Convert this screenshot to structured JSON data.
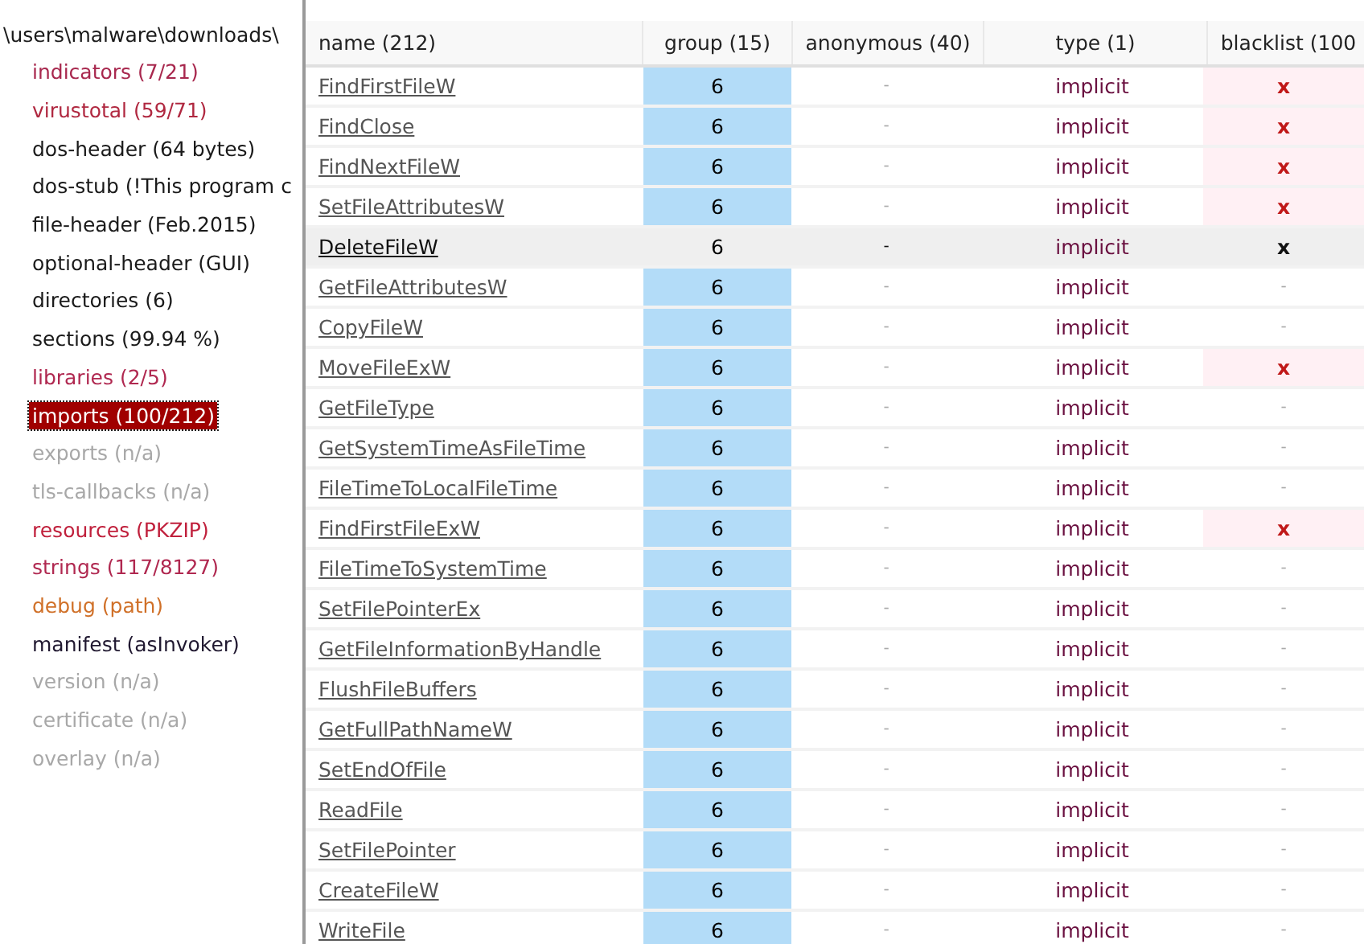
{
  "sidebar": {
    "path": "\\users\\malware\\downloads\\",
    "items": [
      {
        "label": "indicators (7/21)",
        "color": "#a8284e",
        "selected": false
      },
      {
        "label": "virustotal (59/71)",
        "color": "#b02840",
        "selected": false
      },
      {
        "label": "dos-header (64 bytes)",
        "color": "#1a1a1a",
        "selected": false
      },
      {
        "label": "dos-stub (!This program c",
        "color": "#1a1a1a",
        "selected": false
      },
      {
        "label": "file-header (Feb.2015)",
        "color": "#1a1a1a",
        "selected": false
      },
      {
        "label": "optional-header (GUI)",
        "color": "#1a1a1a",
        "selected": false
      },
      {
        "label": "directories (6)",
        "color": "#1a1a1a",
        "selected": false
      },
      {
        "label": "sections (99.94 %)",
        "color": "#1a1a1a",
        "selected": false
      },
      {
        "label": "libraries (2/5)",
        "color": "#b02850",
        "selected": false
      },
      {
        "label": "imports (100/212)",
        "color": "#a00000",
        "selected": true
      },
      {
        "label": "exports (n/a)",
        "color": "#a8a8a8",
        "selected": false
      },
      {
        "label": "tls-callbacks (n/a)",
        "color": "#a8a8a8",
        "selected": false
      },
      {
        "label": "resources (PKZIP)",
        "color": "#c0203c",
        "selected": false
      },
      {
        "label": "strings (117/8127)",
        "color": "#b02850",
        "selected": false
      },
      {
        "label": "debug (path)",
        "color": "#d07028",
        "selected": false
      },
      {
        "label": "manifest (asInvoker)",
        "color": "#201830",
        "selected": false
      },
      {
        "label": "version (n/a)",
        "color": "#a8a8a8",
        "selected": false
      },
      {
        "label": "certificate (n/a)",
        "color": "#a8a8a8",
        "selected": false
      },
      {
        "label": "overlay (n/a)",
        "color": "#a8a8a8",
        "selected": false
      }
    ]
  },
  "table": {
    "columns": [
      "name (212)",
      "group (15)",
      "anonymous (40)",
      "type (1)",
      "blacklist (100"
    ],
    "rows": [
      {
        "name": "FindFirstFileW",
        "group": "6",
        "anonymous": "-",
        "type": "implicit",
        "blacklist": "x",
        "blacklisted": true,
        "selected": false
      },
      {
        "name": "FindClose",
        "group": "6",
        "anonymous": "-",
        "type": "implicit",
        "blacklist": "x",
        "blacklisted": true,
        "selected": false
      },
      {
        "name": "FindNextFileW",
        "group": "6",
        "anonymous": "-",
        "type": "implicit",
        "blacklist": "x",
        "blacklisted": true,
        "selected": false
      },
      {
        "name": "SetFileAttributesW",
        "group": "6",
        "anonymous": "-",
        "type": "implicit",
        "blacklist": "x",
        "blacklisted": true,
        "selected": false
      },
      {
        "name": "DeleteFileW",
        "group": "6",
        "anonymous": "-",
        "type": "implicit",
        "blacklist": "x",
        "blacklisted": true,
        "selected": true
      },
      {
        "name": "GetFileAttributesW",
        "group": "6",
        "anonymous": "-",
        "type": "implicit",
        "blacklist": "-",
        "blacklisted": false,
        "selected": false
      },
      {
        "name": "CopyFileW",
        "group": "6",
        "anonymous": "-",
        "type": "implicit",
        "blacklist": "-",
        "blacklisted": false,
        "selected": false
      },
      {
        "name": "MoveFileExW",
        "group": "6",
        "anonymous": "-",
        "type": "implicit",
        "blacklist": "x",
        "blacklisted": true,
        "selected": false
      },
      {
        "name": "GetFileType",
        "group": "6",
        "anonymous": "-",
        "type": "implicit",
        "blacklist": "-",
        "blacklisted": false,
        "selected": false
      },
      {
        "name": "GetSystemTimeAsFileTime",
        "group": "6",
        "anonymous": "-",
        "type": "implicit",
        "blacklist": "-",
        "blacklisted": false,
        "selected": false
      },
      {
        "name": "FileTimeToLocalFileTime",
        "group": "6",
        "anonymous": "-",
        "type": "implicit",
        "blacklist": "-",
        "blacklisted": false,
        "selected": false
      },
      {
        "name": "FindFirstFileExW",
        "group": "6",
        "anonymous": "-",
        "type": "implicit",
        "blacklist": "x",
        "blacklisted": true,
        "selected": false
      },
      {
        "name": "FileTimeToSystemTime",
        "group": "6",
        "anonymous": "-",
        "type": "implicit",
        "blacklist": "-",
        "blacklisted": false,
        "selected": false
      },
      {
        "name": "SetFilePointerEx",
        "group": "6",
        "anonymous": "-",
        "type": "implicit",
        "blacklist": "-",
        "blacklisted": false,
        "selected": false
      },
      {
        "name": "GetFileInformationByHandle",
        "group": "6",
        "anonymous": "-",
        "type": "implicit",
        "blacklist": "-",
        "blacklisted": false,
        "selected": false
      },
      {
        "name": "FlushFileBuffers",
        "group": "6",
        "anonymous": "-",
        "type": "implicit",
        "blacklist": "-",
        "blacklisted": false,
        "selected": false
      },
      {
        "name": "GetFullPathNameW",
        "group": "6",
        "anonymous": "-",
        "type": "implicit",
        "blacklist": "-",
        "blacklisted": false,
        "selected": false
      },
      {
        "name": "SetEndOfFile",
        "group": "6",
        "anonymous": "-",
        "type": "implicit",
        "blacklist": "-",
        "blacklisted": false,
        "selected": false
      },
      {
        "name": "ReadFile",
        "group": "6",
        "anonymous": "-",
        "type": "implicit",
        "blacklist": "-",
        "blacklisted": false,
        "selected": false
      },
      {
        "name": "SetFilePointer",
        "group": "6",
        "anonymous": "-",
        "type": "implicit",
        "blacklist": "-",
        "blacklisted": false,
        "selected": false
      },
      {
        "name": "CreateFileW",
        "group": "6",
        "anonymous": "-",
        "type": "implicit",
        "blacklist": "-",
        "blacklisted": false,
        "selected": false
      },
      {
        "name": "WriteFile",
        "group": "6",
        "anonymous": "-",
        "type": "implicit",
        "blacklist": "-",
        "blacklisted": false,
        "selected": false
      }
    ]
  }
}
